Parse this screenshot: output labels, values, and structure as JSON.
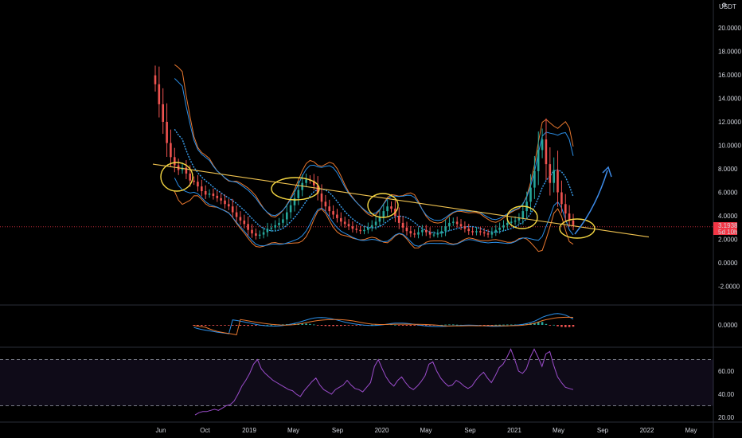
{
  "header": {
    "currency": "USDT"
  },
  "price_badge": {
    "value": "3.1938",
    "time": "5d 10h",
    "color": "#f23645"
  },
  "chart_data": [
    {
      "type": "candlestick",
      "panel": "price",
      "y_ticks": [
        "20.0000",
        "18.0000",
        "16.0000",
        "14.0000",
        "12.0000",
        "10.0000",
        "8.0000",
        "6.0000",
        "4.0000",
        "2.0000",
        "0.0000",
        "-2.0000"
      ],
      "ylim": [
        -3,
        22
      ],
      "x_ticks": [
        "Jun",
        "Oct",
        "2019",
        "May",
        "Sep",
        "2020",
        "May",
        "Sep",
        "2021",
        "May",
        "Sep",
        "2022",
        "May"
      ],
      "series": {
        "closes": [
          15.2,
          13.5,
          12.0,
          10.2,
          9.0,
          8.3,
          7.9,
          8.1,
          7.6,
          7.0,
          6.9,
          6.5,
          6.1,
          5.8,
          5.9,
          5.7,
          5.5,
          5.3,
          5.0,
          4.8,
          4.3,
          3.9,
          3.6,
          3.3,
          2.8,
          2.5,
          2.3,
          2.4,
          2.6,
          2.9,
          3.0,
          3.2,
          3.4,
          3.7,
          4.3,
          4.9,
          5.5,
          6.2,
          6.8,
          7.1,
          7.0,
          6.6,
          5.9,
          5.2,
          4.8,
          4.4,
          4.1,
          3.8,
          3.5,
          3.3,
          3.1,
          2.9,
          2.8,
          2.7,
          2.8,
          3.0,
          3.2,
          3.5,
          3.9,
          4.4,
          4.8,
          4.6,
          4.0,
          3.4,
          3.0,
          2.7,
          2.5,
          2.4,
          2.6,
          2.8,
          2.6,
          2.4,
          2.4,
          2.5,
          2.7,
          3.1,
          3.4,
          3.5,
          3.3,
          3.1,
          2.9,
          2.7,
          2.6,
          2.7,
          2.6,
          2.5,
          2.4,
          2.6,
          2.8,
          3.0,
          3.2,
          3.4,
          3.5,
          3.6,
          3.8,
          4.4,
          5.2,
          6.4,
          7.8,
          9.6,
          10.5,
          8.4,
          6.8,
          7.9,
          6.0,
          5.0,
          4.2,
          3.6,
          3.2
        ]
      },
      "indicators": [
        "Bollinger Bands",
        "Moving Average",
        "Trendline"
      ]
    },
    {
      "type": "histogram",
      "panel": "macd",
      "y_ticks": [
        "0.0000"
      ]
    },
    {
      "type": "line",
      "panel": "rsi",
      "y_ticks": [
        "60.00",
        "40.00",
        "20.00"
      ],
      "ylim": [
        17,
        88
      ],
      "bands": [
        70,
        30
      ],
      "values": [
        22,
        24,
        25,
        25,
        26,
        27,
        26,
        28,
        30,
        31,
        34,
        40,
        47,
        52,
        58,
        66,
        70,
        62,
        58,
        55,
        52,
        50,
        48,
        46,
        44,
        43,
        40,
        38,
        43,
        47,
        51,
        54,
        48,
        44,
        42,
        40,
        44,
        46,
        48,
        52,
        48,
        45,
        44,
        42,
        46,
        50,
        64,
        70,
        62,
        55,
        50,
        47,
        52,
        55,
        50,
        46,
        44,
        47,
        51,
        56,
        66,
        68,
        60,
        54,
        50,
        47,
        48,
        52,
        50,
        47,
        45,
        47,
        52,
        56,
        59,
        54,
        50,
        56,
        63,
        66,
        72,
        79,
        70,
        60,
        58,
        62,
        72,
        79,
        72,
        64,
        75,
        77,
        65,
        55,
        50,
        46,
        45,
        44
      ]
    }
  ]
}
